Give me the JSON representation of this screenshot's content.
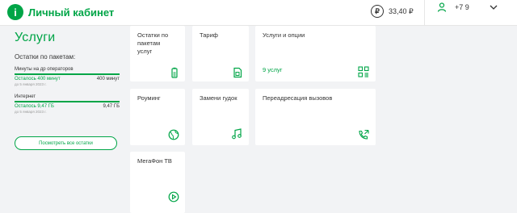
{
  "header": {
    "logo_mark": "і",
    "logo_text": "Личный кабинет",
    "currency_symbol": "₽",
    "balance": "33,40 ₽",
    "phone": "+7 9"
  },
  "sidebar": {
    "title": "Услуги",
    "packages_label": "Остатки по пакетам:",
    "packages": [
      {
        "name": "Минуты на др операторов",
        "remaining": "Осталось 400 минут",
        "total": "400 минут",
        "until": "до 5 января 2023 г."
      },
      {
        "name": "Интернет",
        "remaining": "Осталось 9,47 ГБ",
        "total": "9,47 ГБ",
        "until": "до 5 января 2023 г."
      }
    ],
    "view_all_button": "Посмотреть все остатки"
  },
  "tiles": [
    {
      "label": "Остатки по\nпакетам\nуслуг",
      "icon": "battery-icon"
    },
    {
      "label": "Тариф",
      "icon": "sim-card-icon"
    },
    {
      "label": "Услуги и опции",
      "sub": "9 услуг",
      "icon": "qr-list-icon"
    },
    {
      "label": "Роуминг",
      "icon": "globe-icon"
    },
    {
      "label": "Замени гудок",
      "icon": "music-note-icon"
    },
    {
      "label": "Переадресация вызовов",
      "icon": "call-forward-icon"
    },
    {
      "label": "МегаФон ТВ",
      "icon": "play-icon"
    }
  ],
  "colors": {
    "accent": "#00a547",
    "background": "#f2f3f5",
    "text": "#333333"
  }
}
